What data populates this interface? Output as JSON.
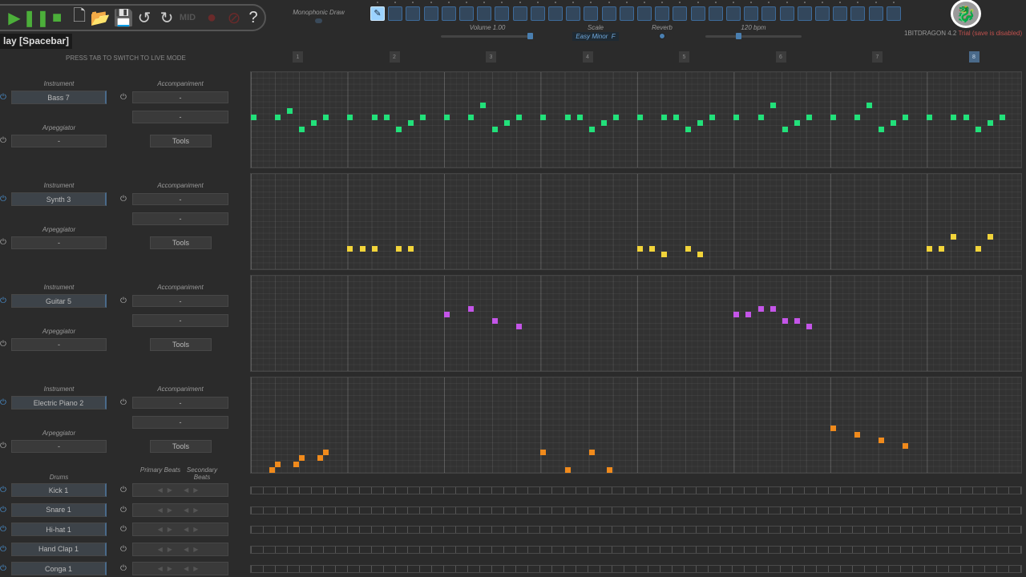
{
  "toolbar": {
    "buttons": [
      {
        "name": "play-button",
        "icon": "play-icon",
        "glyph": "▶",
        "color": "#4caf3a"
      },
      {
        "name": "pause-button",
        "icon": "pause-icon",
        "glyph": "❚❚",
        "color": "#4caf3a"
      },
      {
        "name": "stop-button",
        "icon": "stop-icon",
        "glyph": "■",
        "color": "#4caf3a"
      },
      {
        "name": "new-file-button",
        "icon": "file-icon",
        "glyph": "🗋",
        "color": "#ccc"
      },
      {
        "name": "open-button",
        "icon": "folder-open-icon",
        "glyph": "📂",
        "color": "#ccc"
      },
      {
        "name": "save-button",
        "icon": "floppy-icon",
        "glyph": "💾",
        "color": "#555"
      },
      {
        "name": "undo-button",
        "icon": "undo-icon",
        "glyph": "↺",
        "color": "#ccc"
      },
      {
        "name": "redo-button",
        "icon": "redo-icon",
        "glyph": "↻",
        "color": "#ccc"
      },
      {
        "name": "midi-button",
        "icon": "midi-icon",
        "glyph": "MID",
        "color": "#555"
      },
      {
        "name": "record-button",
        "icon": "record-icon",
        "glyph": "●",
        "color": "#6a2a2a"
      },
      {
        "name": "loop-record-button",
        "icon": "loop-icon",
        "glyph": "⊘",
        "color": "#6a2a2a"
      },
      {
        "name": "help-button",
        "icon": "help-icon",
        "glyph": "?",
        "color": "#ddd"
      }
    ],
    "tooltip": "lay [Spacebar]",
    "monophonic_label": "Monophonic Draw"
  },
  "patterns": {
    "count": 30,
    "selected": 0,
    "selected_icon": "pencil-icon"
  },
  "controls": {
    "volume_label": "Volume 1.00",
    "volume": 1.0,
    "scale_label": "Scale",
    "scale_value": "Easy Minor  F",
    "reverb_label": "Reverb",
    "tempo_label": "120 bpm",
    "tempo": 120
  },
  "brand": {
    "name": "1BITDRAGON 4.2",
    "trial": "Trial (save is disabled)",
    "logo_icon": "dragon-logo-icon"
  },
  "live_mode_hint": "PRESS TAB TO SWITCH TO LIVE MODE",
  "bars": {
    "labels": [
      "1",
      "2",
      "3",
      "4",
      "5",
      "6",
      "7",
      "8"
    ],
    "current": 8
  },
  "labels": {
    "instrument": "Instrument",
    "accompaniment": "Accompaniment",
    "arpeggiator": "Arpeggiator",
    "tools": "Tools",
    "dash": "-",
    "drums": "Drums",
    "primary": "Primary Beats",
    "secondary": "Secondary Beats"
  },
  "tracks": [
    {
      "instrument": "Bass 7",
      "color": "#22e07a",
      "notes": [
        [
          0,
          7
        ],
        [
          2,
          7
        ],
        [
          3,
          6
        ],
        [
          4,
          9
        ],
        [
          5,
          8
        ],
        [
          6,
          7
        ],
        [
          8,
          7
        ],
        [
          10,
          7
        ],
        [
          11,
          7
        ],
        [
          12,
          9
        ],
        [
          13,
          8
        ],
        [
          14,
          7
        ],
        [
          16,
          7
        ],
        [
          18,
          7
        ],
        [
          19,
          5
        ],
        [
          20,
          9
        ],
        [
          21,
          8
        ],
        [
          22,
          7
        ],
        [
          24,
          7
        ],
        [
          26,
          7
        ],
        [
          27,
          7
        ],
        [
          28,
          9
        ],
        [
          29,
          8
        ],
        [
          30,
          7
        ],
        [
          32,
          7
        ],
        [
          34,
          7
        ],
        [
          35,
          7
        ],
        [
          36,
          9
        ],
        [
          37,
          8
        ],
        [
          38,
          7
        ],
        [
          40,
          7
        ],
        [
          42,
          7
        ],
        [
          43,
          5
        ],
        [
          44,
          9
        ],
        [
          45,
          8
        ],
        [
          46,
          7
        ],
        [
          48,
          7
        ],
        [
          50,
          7
        ],
        [
          51,
          5
        ],
        [
          52,
          9
        ],
        [
          53,
          8
        ],
        [
          54,
          7
        ],
        [
          56,
          7
        ],
        [
          58,
          7
        ],
        [
          59,
          7
        ],
        [
          60,
          9
        ],
        [
          61,
          8
        ],
        [
          62,
          7
        ]
      ]
    },
    {
      "instrument": "Synth 3",
      "color": "#f2d43a",
      "notes": [
        [
          8,
          12
        ],
        [
          9,
          12
        ],
        [
          10,
          12
        ],
        [
          12,
          12
        ],
        [
          13,
          12
        ],
        [
          32,
          12
        ],
        [
          33,
          12
        ],
        [
          34,
          13
        ],
        [
          36,
          12
        ],
        [
          37,
          13
        ],
        [
          56,
          12
        ],
        [
          57,
          12
        ],
        [
          58,
          10
        ],
        [
          60,
          12
        ],
        [
          61,
          10
        ]
      ]
    },
    {
      "instrument": "Guitar 5",
      "color": "#c455e8",
      "notes": [
        [
          16,
          6
        ],
        [
          18,
          5
        ],
        [
          20,
          7
        ],
        [
          22,
          8
        ],
        [
          40,
          6
        ],
        [
          41,
          6
        ],
        [
          42,
          5
        ],
        [
          43,
          5
        ],
        [
          44,
          7
        ],
        [
          45,
          7
        ],
        [
          46,
          8
        ]
      ]
    },
    {
      "instrument": "Electric Piano 2",
      "color": "#f08a1c",
      "notes": [
        [
          1.5,
          15
        ],
        [
          2,
          14
        ],
        [
          3.5,
          14
        ],
        [
          4,
          13
        ],
        [
          5.5,
          13
        ],
        [
          6,
          12
        ],
        [
          24,
          12
        ],
        [
          26,
          15
        ],
        [
          28,
          12
        ],
        [
          29.5,
          15
        ],
        [
          48,
          8
        ],
        [
          50,
          9
        ],
        [
          52,
          10
        ],
        [
          54,
          11
        ]
      ]
    }
  ],
  "drums": [
    "Kick 1",
    "Snare 1",
    "Hi-hat 1",
    "Hand Clap 1",
    "Conga 1"
  ]
}
